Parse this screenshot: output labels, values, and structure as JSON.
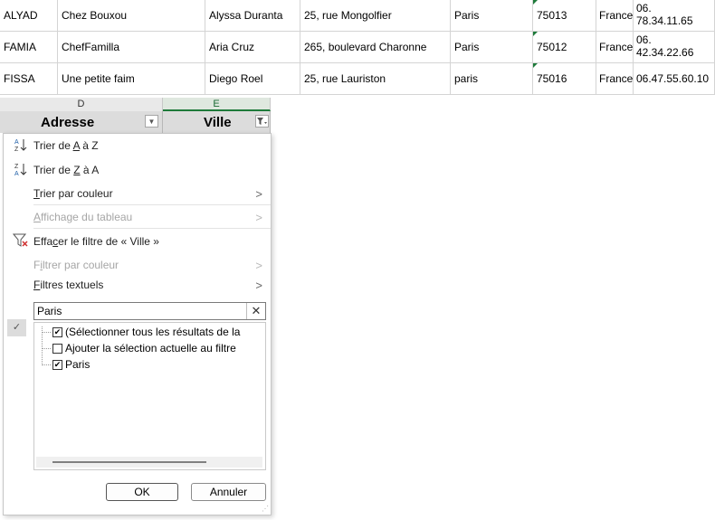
{
  "rows": [
    {
      "code": "ALYAD",
      "company": "Chez Bouxou",
      "contact": "Alyssa Duranta",
      "address": "25, rue Mongolfier",
      "city": "Paris",
      "zip": "75013",
      "country": "France",
      "phone1": "06.",
      "phone2": "78.34.11.65"
    },
    {
      "code": "FAMIA",
      "company": "ChefFamilla",
      "contact": "Aria Cruz",
      "address": "265, boulevard Charonne",
      "city": "Paris",
      "zip": "75012",
      "country": "France",
      "phone1": "06.",
      "phone2": "42.34.22.66"
    },
    {
      "code": "FISSA",
      "company": "Une petite faim",
      "contact": "Diego Roel",
      "address": "25, rue Lauriston",
      "city": "paris",
      "zip": "75016",
      "country": "France",
      "phone1": "06.47.55.60.10",
      "phone2": ""
    }
  ],
  "columns": {
    "d_letter": "D",
    "e_letter": "E",
    "d_header": "Adresse",
    "e_header": "Ville"
  },
  "menu": {
    "sort_asc_pre": "Trier de ",
    "sort_asc_a": "A",
    "sort_asc_post": " à Z",
    "sort_desc_pre": "Trier de ",
    "sort_desc_z": "Z",
    "sort_desc_post": " à A",
    "sort_color_t": "T",
    "sort_color_rest": "rier par couleur",
    "table_view_a": "A",
    "table_view_rest": "ffichage du tableau",
    "clear_pre": "Effa",
    "clear_c": "c",
    "clear_post": "er le filtre de « Ville »",
    "filter_color_pre": "F",
    "filter_color_i": "i",
    "filter_color_post": "ltrer par couleur",
    "text_filters_f": "F",
    "text_filters_rest": "iltres textuels"
  },
  "search": {
    "value": "Paris"
  },
  "list": {
    "select_all": "(Sélectionner tous les résultats de la",
    "add_selection": "Ajouter la sélection actuelle au filtre",
    "paris": "Paris"
  },
  "buttons": {
    "ok": "OK",
    "cancel": "Annuler"
  },
  "icons": {
    "sort_asc": "sort-ascending-icon",
    "sort_desc": "sort-descending-icon",
    "clear_filter": "clear-filter-icon",
    "filter": "filter-icon",
    "dropdown": "chevron-down-icon"
  },
  "colors": {
    "accent": "#1e7a3a",
    "clear_icon_red": "#d03030"
  }
}
